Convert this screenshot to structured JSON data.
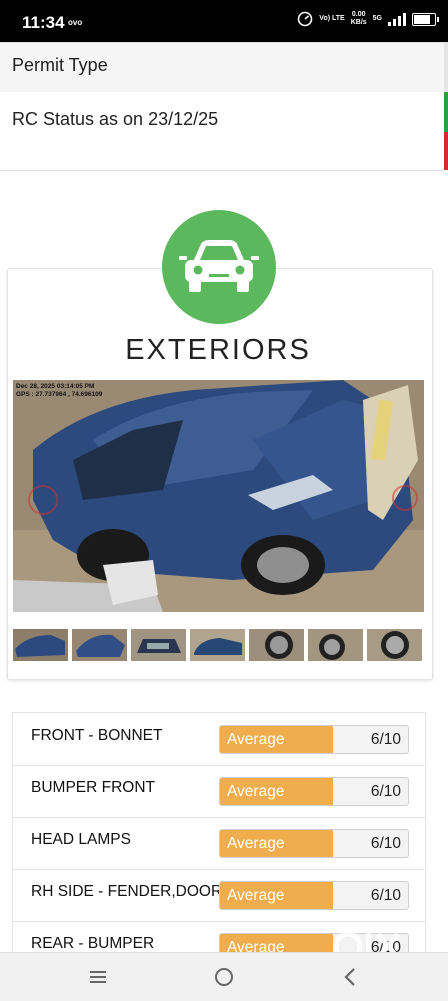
{
  "status_bar": {
    "time": "11:34",
    "carrier": "ovo",
    "network_top": "Vo) LTE",
    "data_speed_value": "0.00",
    "data_speed_unit": "KB/s",
    "network_type": "5G",
    "icons": [
      "speedometer-icon",
      "signal-icon",
      "battery-icon"
    ]
  },
  "rows": {
    "permit_type": "Permit Type",
    "rc_status": "RC Status as on 23/12/25"
  },
  "section": {
    "icon": "car-icon",
    "title": "EXTERIORS",
    "accent_color": "#5cb85c"
  },
  "photo": {
    "timestamp": "Dec 28, 2025 03:14:05 PM",
    "gps": "GPS : 27.737964 , 74.696109",
    "thumbnail_count": 7
  },
  "ratings": [
    {
      "name": "FRONT - BONNET",
      "label": "Average",
      "score_text": "6/10",
      "score": 6,
      "max": 10
    },
    {
      "name": "BUMPER FRONT",
      "label": "Average",
      "score_text": "6/10",
      "score": 6,
      "max": 10
    },
    {
      "name": "HEAD LAMPS",
      "label": "Average",
      "score_text": "6/10",
      "score": 6,
      "max": 10
    },
    {
      "name": "RH SIDE - FENDER,DOORS",
      "label": "Average",
      "score_text": "6/10",
      "score": 6,
      "max": 10
    },
    {
      "name": "REAR - BUMPER",
      "label": "Average",
      "score_text": "6/10",
      "score": 6,
      "max": 10
    }
  ],
  "colors": {
    "rating_fill": "#f0ad4e",
    "green_strip": "#2e9f3e",
    "red_strip": "#d62b2b"
  },
  "watermark": "OLX",
  "nav": [
    "recent-apps-icon",
    "home-icon",
    "back-icon"
  ]
}
